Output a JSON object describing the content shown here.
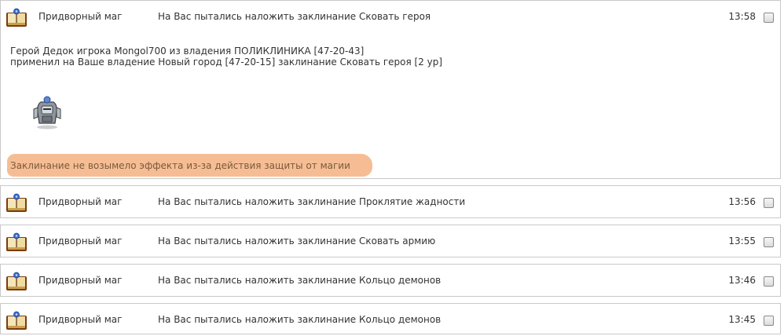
{
  "messages": [
    {
      "sender": "Придворный маг",
      "subject": "На Вас пытались наложить заклинание Сковать героя",
      "time": "13:58",
      "expanded": true,
      "body": [
        "Герой Дедок игрока Mongol700 из владения ПОЛИКЛИНИКА [47-20-43]",
        "применил на Ваше владение Новый город [47-20-15] заклинание Сковать героя [2 ур]"
      ],
      "note": "Заклинание не возымело эффекта из-за действия защиты от магии"
    },
    {
      "sender": "Придворный маг",
      "subject": "На Вас пытались наложить заклинание Проклятие жадности",
      "time": "13:56"
    },
    {
      "sender": "Придворный маг",
      "subject": "На Вас пытались наложить заклинание Сковать армию",
      "time": "13:55"
    },
    {
      "sender": "Придворный маг",
      "subject": "На Вас пытались наложить заклинание Кольцо демонов",
      "time": "13:46"
    },
    {
      "sender": "Придворный маг",
      "subject": "На Вас пытались наложить заклинание Кольцо демонов",
      "time": "13:45"
    }
  ],
  "colors": {
    "highlight": "#f4b183",
    "border": "#c9c9c9",
    "text": "#333333"
  },
  "icons": {
    "message": "spellbook-icon",
    "unit": "knight-unit-icon"
  }
}
